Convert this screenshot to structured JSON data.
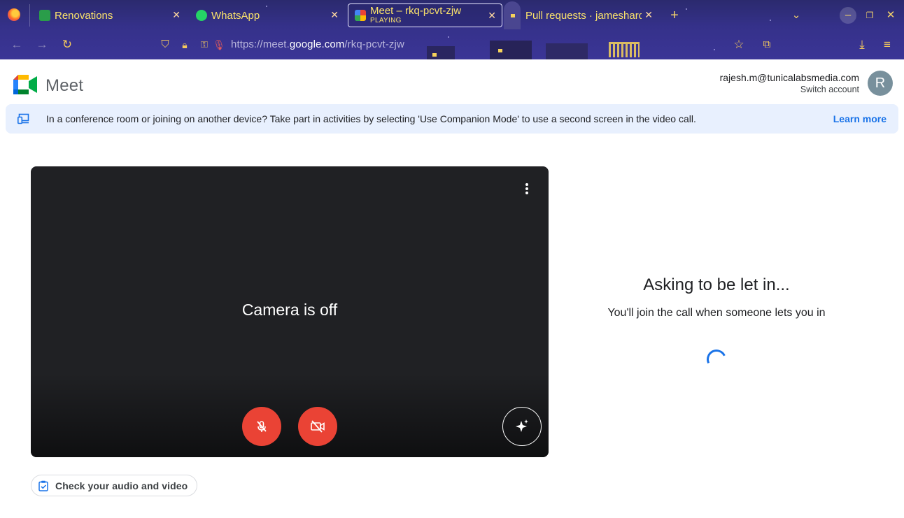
{
  "browser": {
    "tabs": [
      {
        "title": "Renovations",
        "favicon": "renovations-favicon",
        "active": false
      },
      {
        "title": "WhatsApp",
        "favicon": "whatsapp-favicon",
        "active": false
      },
      {
        "title": "Meet – rkq-pcvt-zjw",
        "subtitle": "PLAYING",
        "favicon": "meet-favicon",
        "active": true
      },
      {
        "title": "Pull requests · jameshard",
        "favicon": "github-favicon",
        "active": false
      }
    ],
    "new_tab": "+",
    "url_prefix": "https://meet.",
    "url_domain": "google.com",
    "url_path": "/rkq-pcvt-zjw",
    "accent_color": "#fbe36b"
  },
  "meet": {
    "app_name": "Meet",
    "account": {
      "email": "rajesh.m@tunicalabsmedia.com",
      "switch_label": "Switch account",
      "avatar_letter": "R"
    },
    "banner": {
      "message": "In a conference room or joining on another device? Take part in activities by selecting 'Use Companion Mode' to use a second screen in the video call.",
      "link": "Learn more"
    },
    "preview": {
      "camera_status": "Camera is off",
      "mic_muted": true,
      "camera_disabled": true
    },
    "check_av_label": "Check your audio and video",
    "status": {
      "heading": "Asking to be let in...",
      "message": "You'll join the call when someone lets you in"
    },
    "colors": {
      "brand_blue": "#1a73e8",
      "danger_red": "#ea4335",
      "banner_bg": "#e8f0fe"
    }
  }
}
